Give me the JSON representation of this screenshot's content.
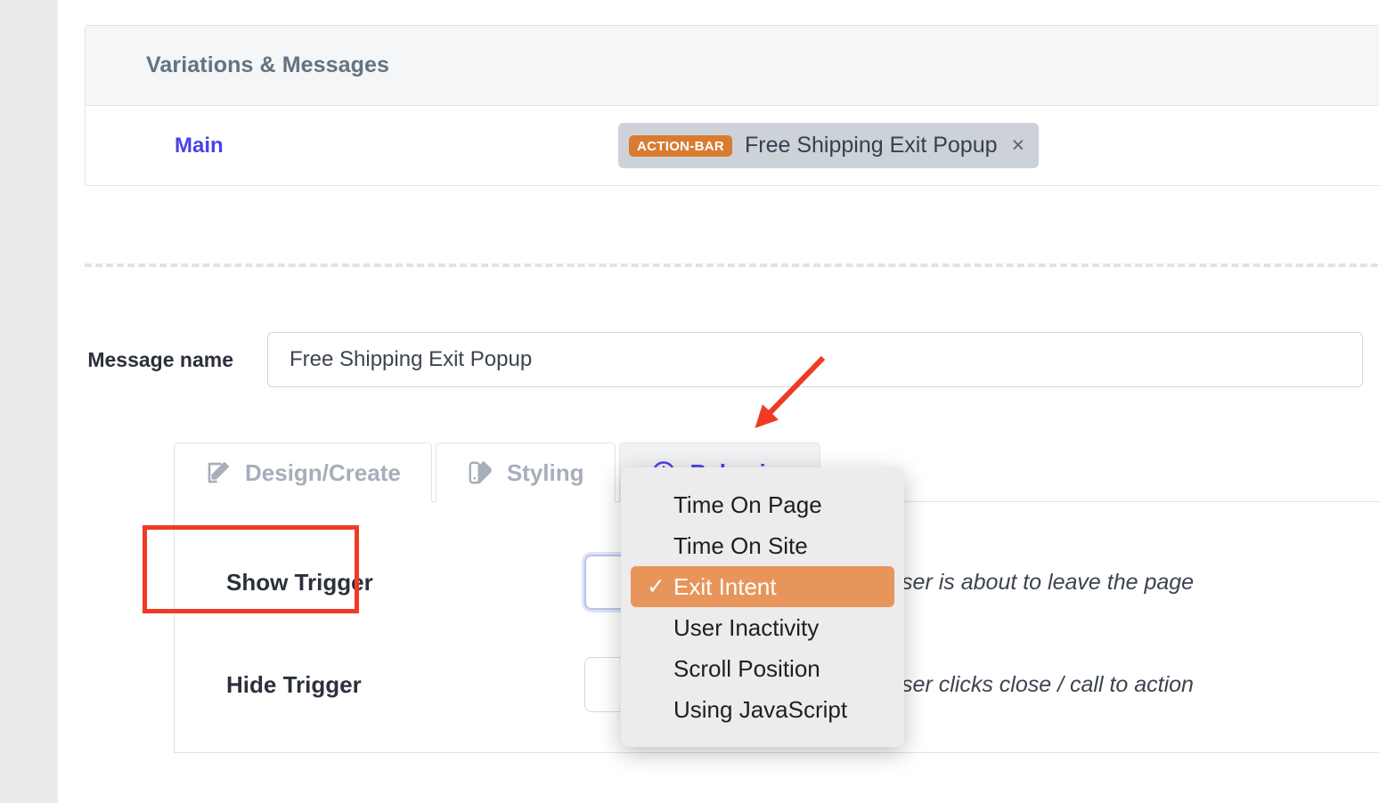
{
  "variations_panel": {
    "title": "Variations & Messages",
    "variation_name": "Main",
    "message_chip": {
      "type_badge": "ACTION-BAR",
      "label": "Free Shipping Exit Popup",
      "close_icon": "×",
      "badge_color": "#d97c30",
      "chip_background": "#cdd2d8"
    }
  },
  "message_name": {
    "label": "Message name",
    "value": "Free Shipping Exit Popup",
    "placeholder": "Message name"
  },
  "tabs": [
    {
      "label": "Design/Create",
      "icon": "edit-square-icon",
      "active": false
    },
    {
      "label": "Styling",
      "icon": "palette-icon",
      "active": false
    },
    {
      "label": "Behavior",
      "icon": "clock-icon",
      "active": true
    }
  ],
  "behavior_panel": {
    "rows": [
      {
        "label": "Show Trigger",
        "selected_value": "Exit Intent",
        "hint": "User is about to leave the page",
        "focused": true
      },
      {
        "label": "Hide Trigger",
        "selected_value": "",
        "hint": "User clicks close / call to action",
        "focused": false
      }
    ]
  },
  "trigger_dropdown": {
    "selected": "Exit Intent",
    "highlight_color": "#e8955b",
    "check_glyph": "✓",
    "options": [
      "Time On Page",
      "Time On Site",
      "Exit Intent",
      "User Inactivity",
      "Scroll Position",
      "Using JavaScript"
    ]
  },
  "annotations": {
    "highlight_color": "#ef3b24",
    "arrow_target": "Behavior tab",
    "box_target": "Show Trigger"
  }
}
